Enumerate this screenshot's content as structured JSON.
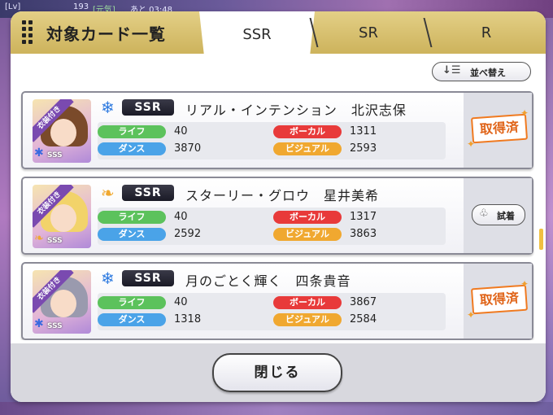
{
  "background_hud": {
    "level_tag": "[Lv]",
    "level_value": "193",
    "mood": "[元気]",
    "timer": "あと 03:48"
  },
  "dialog": {
    "title": "対象カード一覧",
    "tabs": [
      {
        "label": "SSR",
        "active": true
      },
      {
        "label": "SR",
        "active": false
      },
      {
        "label": "R",
        "active": false
      }
    ],
    "sort_label": "並べ替え",
    "close_label": "閉じる"
  },
  "cards": [
    {
      "type_icon": "snowflake-icon",
      "type_color": "#2f7be0",
      "rarity": "SSR",
      "name": "リアル・インテンション　北沢志保",
      "costume_tag": "衣装付き",
      "rank_tag": "SSS",
      "stats": {
        "life_label": "ライフ",
        "life": "40",
        "dance_label": "ダンス",
        "dance": "3870",
        "vocal_label": "ボーカル",
        "vocal": "1311",
        "visual_label": "ビジュアル",
        "visual": "2593"
      },
      "status": "取得済"
    },
    {
      "type_icon": "wing-icon",
      "type_color": "#f0a830",
      "rarity": "SSR",
      "name": "スターリー・グロウ　星井美希",
      "costume_tag": "衣装付き",
      "rank_tag": "SSS",
      "stats": {
        "life_label": "ライフ",
        "life": "40",
        "dance_label": "ダンス",
        "dance": "2592",
        "vocal_label": "ボーカル",
        "vocal": "1317",
        "visual_label": "ビジュアル",
        "visual": "3863"
      },
      "action": "試着"
    },
    {
      "type_icon": "snowflake-icon",
      "type_color": "#2f7be0",
      "rarity": "SSR",
      "name": "月のごとく輝く　四条貴音",
      "costume_tag": "衣装付き",
      "rank_tag": "SSS",
      "stats": {
        "life_label": "ライフ",
        "life": "40",
        "dance_label": "ダンス",
        "dance": "1318",
        "vocal_label": "ボーカル",
        "vocal": "3867",
        "visual_label": "ビジュアル",
        "visual": "2584"
      },
      "status": "取得済"
    }
  ],
  "colors": {
    "header_gold": "#d9c273",
    "life": "#5cc25c",
    "dance": "#4aa3e8",
    "vocal": "#e83a3a",
    "visual": "#f0a830",
    "acquired": "#e0651a"
  }
}
